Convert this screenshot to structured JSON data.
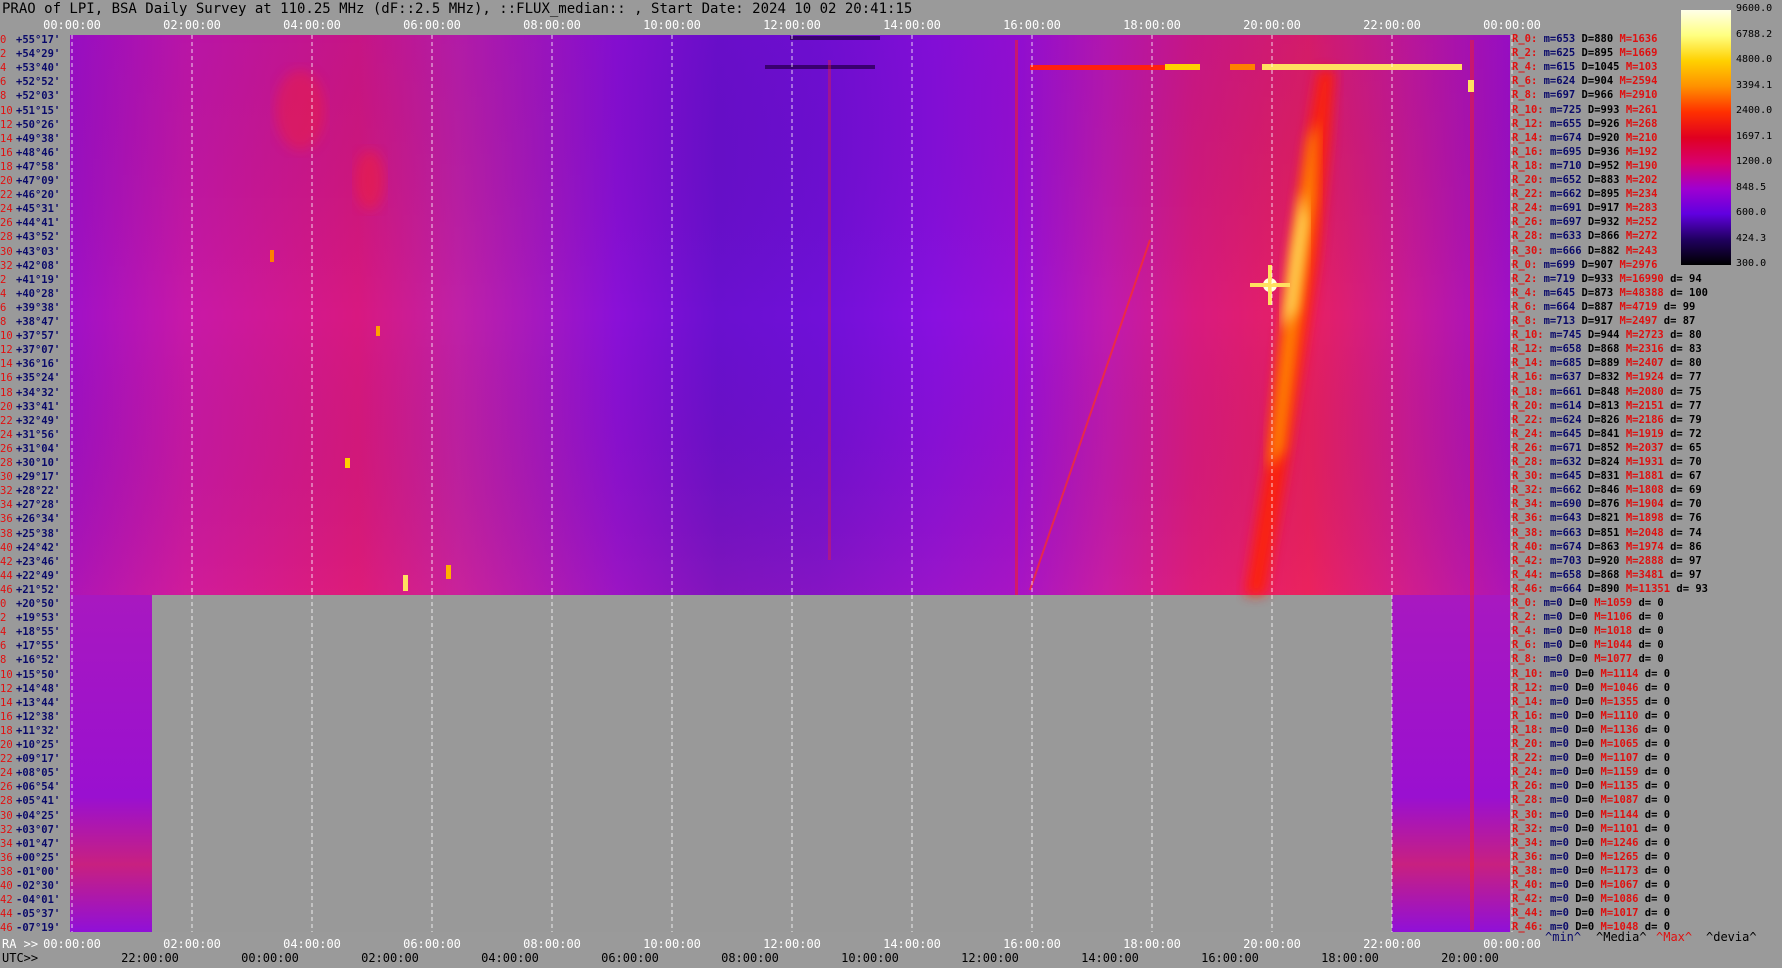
{
  "title": "PRAO of LPI, BSA Daily Survey at 110.25 MHz (dF::2.5 MHz), ::FLUX_median:: , Start Date: 2024 10 02 20:41:15",
  "top_axis": [
    "00:00:00",
    "02:00:00",
    "04:00:00",
    "06:00:00",
    "08:00:00",
    "10:00:00",
    "12:00:00",
    "14:00:00",
    "16:00:00",
    "18:00:00",
    "20:00:00",
    "22:00:00",
    "00:00:00"
  ],
  "ra_axis_label": "RA >>",
  "ra_axis": [
    "00:00:00",
    "02:00:00",
    "04:00:00",
    "06:00:00",
    "08:00:00",
    "10:00:00",
    "12:00:00",
    "14:00:00",
    "16:00:00",
    "18:00:00",
    "20:00:00",
    "22:00:00",
    "00:00:00"
  ],
  "utc_axis_label": "UTC>>",
  "utc_axis": [
    "22:00:00",
    "00:00:00",
    "02:00:00",
    "04:00:00",
    "06:00:00",
    "08:00:00",
    "10:00:00",
    "12:00:00",
    "14:00:00",
    "16:00:00",
    "18:00:00",
    "20:00:00"
  ],
  "declinations": [
    {
      "idx": "0",
      "dec": "+55°17'"
    },
    {
      "idx": "2",
      "dec": "+54°29'"
    },
    {
      "idx": "4",
      "dec": "+53°40'"
    },
    {
      "idx": "6",
      "dec": "+52°52'"
    },
    {
      "idx": "8",
      "dec": "+52°03'"
    },
    {
      "idx": "10",
      "dec": "+51°15'"
    },
    {
      "idx": "12",
      "dec": "+50°26'"
    },
    {
      "idx": "14",
      "dec": "+49°38'"
    },
    {
      "idx": "16",
      "dec": "+48°46'"
    },
    {
      "idx": "18",
      "dec": "+47°58'"
    },
    {
      "idx": "20",
      "dec": "+47°09'"
    },
    {
      "idx": "22",
      "dec": "+46°20'"
    },
    {
      "idx": "24",
      "dec": "+45°31'"
    },
    {
      "idx": "26",
      "dec": "+44°41'"
    },
    {
      "idx": "28",
      "dec": "+43°52'"
    },
    {
      "idx": "30",
      "dec": "+43°03'"
    },
    {
      "idx": "32",
      "dec": "+42°08'"
    },
    {
      "idx": "2",
      "dec": "+41°19'"
    },
    {
      "idx": "4",
      "dec": "+40°28'"
    },
    {
      "idx": "6",
      "dec": "+39°38'"
    },
    {
      "idx": "8",
      "dec": "+38°47'"
    },
    {
      "idx": "10",
      "dec": "+37°57'"
    },
    {
      "idx": "12",
      "dec": "+37°07'"
    },
    {
      "idx": "14",
      "dec": "+36°16'"
    },
    {
      "idx": "16",
      "dec": "+35°24'"
    },
    {
      "idx": "18",
      "dec": "+34°32'"
    },
    {
      "idx": "20",
      "dec": "+33°41'"
    },
    {
      "idx": "22",
      "dec": "+32°49'"
    },
    {
      "idx": "24",
      "dec": "+31°56'"
    },
    {
      "idx": "26",
      "dec": "+31°04'"
    },
    {
      "idx": "28",
      "dec": "+30°10'"
    },
    {
      "idx": "30",
      "dec": "+29°17'"
    },
    {
      "idx": "32",
      "dec": "+28°22'"
    },
    {
      "idx": "34",
      "dec": "+27°28'"
    },
    {
      "idx": "36",
      "dec": "+26°34'"
    },
    {
      "idx": "38",
      "dec": "+25°38'"
    },
    {
      "idx": "40",
      "dec": "+24°42'"
    },
    {
      "idx": "42",
      "dec": "+23°46'"
    },
    {
      "idx": "44",
      "dec": "+22°49'"
    },
    {
      "idx": "46",
      "dec": "+21°52'"
    },
    {
      "idx": "0",
      "dec": "+20°50'"
    },
    {
      "idx": "2",
      "dec": "+19°53'"
    },
    {
      "idx": "4",
      "dec": "+18°55'"
    },
    {
      "idx": "6",
      "dec": "+17°55'"
    },
    {
      "idx": "8",
      "dec": "+16°52'"
    },
    {
      "idx": "10",
      "dec": "+15°50'"
    },
    {
      "idx": "12",
      "dec": "+14°48'"
    },
    {
      "idx": "14",
      "dec": "+13°44'"
    },
    {
      "idx": "16",
      "dec": "+12°38'"
    },
    {
      "idx": "18",
      "dec": "+11°32'"
    },
    {
      "idx": "20",
      "dec": "+10°25'"
    },
    {
      "idx": "22",
      "dec": "+09°17'"
    },
    {
      "idx": "24",
      "dec": "+08°05'"
    },
    {
      "idx": "26",
      "dec": "+06°54'"
    },
    {
      "idx": "28",
      "dec": "+05°41'"
    },
    {
      "idx": "30",
      "dec": "+04°25'"
    },
    {
      "idx": "32",
      "dec": "+03°07'"
    },
    {
      "idx": "34",
      "dec": "+01°47'"
    },
    {
      "idx": "36",
      "dec": "+00°25'"
    },
    {
      "idx": "38",
      "dec": "-01°00'"
    },
    {
      "idx": "40",
      "dec": "-02°30'"
    },
    {
      "idx": "42",
      "dec": "-04°01'"
    },
    {
      "idx": "44",
      "dec": "-05°37'"
    },
    {
      "idx": "46",
      "dec": "-07°19'"
    }
  ],
  "stats": [
    {
      "r": "R_0:",
      "m": "m=653",
      "d": "D=880",
      "M": "M=1636",
      "dev": ""
    },
    {
      "r": "R_2:",
      "m": "m=625",
      "d": "D=895",
      "M": "M=1669",
      "dev": ""
    },
    {
      "r": "R_4:",
      "m": "m=615",
      "d": "D=1045",
      "M": "M=103",
      "dev": ""
    },
    {
      "r": "R_6:",
      "m": "m=624",
      "d": "D=904",
      "M": "M=2594",
      "dev": ""
    },
    {
      "r": "R_8:",
      "m": "m=697",
      "d": "D=966",
      "M": "M=2910",
      "dev": ""
    },
    {
      "r": "R_10:",
      "m": "m=725",
      "d": "D=993",
      "M": "M=261",
      "dev": ""
    },
    {
      "r": "R_12:",
      "m": "m=655",
      "d": "D=926",
      "M": "M=268",
      "dev": ""
    },
    {
      "r": "R_14:",
      "m": "m=674",
      "d": "D=920",
      "M": "M=210",
      "dev": ""
    },
    {
      "r": "R_16:",
      "m": "m=695",
      "d": "D=936",
      "M": "M=192",
      "dev": ""
    },
    {
      "r": "R_18:",
      "m": "m=710",
      "d": "D=952",
      "M": "M=190",
      "dev": ""
    },
    {
      "r": "R_20:",
      "m": "m=652",
      "d": "D=883",
      "M": "M=202",
      "dev": ""
    },
    {
      "r": "R_22:",
      "m": "m=662",
      "d": "D=895",
      "M": "M=234",
      "dev": ""
    },
    {
      "r": "R_24:",
      "m": "m=691",
      "d": "D=917",
      "M": "M=283",
      "dev": ""
    },
    {
      "r": "R_26:",
      "m": "m=697",
      "d": "D=932",
      "M": "M=252",
      "dev": ""
    },
    {
      "r": "R_28:",
      "m": "m=633",
      "d": "D=866",
      "M": "M=272",
      "dev": ""
    },
    {
      "r": "R_30:",
      "m": "m=666",
      "d": "D=882",
      "M": "M=243",
      "dev": ""
    },
    {
      "r": "R_0:",
      "m": "m=699",
      "d": "D=907",
      "M": "M=2976",
      "dev": ""
    },
    {
      "r": "R_2:",
      "m": "m=719",
      "d": "D=933",
      "M": "M=16990",
      "dev": "d= 94"
    },
    {
      "r": "R_4:",
      "m": "m=645",
      "d": "D=873",
      "M": "M=48388",
      "dev": "d= 100"
    },
    {
      "r": "R_6:",
      "m": "m=664",
      "d": "D=887",
      "M": "M=4719",
      "dev": "d= 99"
    },
    {
      "r": "R_8:",
      "m": "m=713",
      "d": "D=917",
      "M": "M=2497",
      "dev": "d= 87"
    },
    {
      "r": "R_10:",
      "m": "m=745",
      "d": "D=944",
      "M": "M=2723",
      "dev": "d= 80"
    },
    {
      "r": "R_12:",
      "m": "m=658",
      "d": "D=868",
      "M": "M=2316",
      "dev": "d= 83"
    },
    {
      "r": "R_14:",
      "m": "m=685",
      "d": "D=889",
      "M": "M=2407",
      "dev": "d= 80"
    },
    {
      "r": "R_16:",
      "m": "m=637",
      "d": "D=832",
      "M": "M=1924",
      "dev": "d= 77"
    },
    {
      "r": "R_18:",
      "m": "m=661",
      "d": "D=848",
      "M": "M=2080",
      "dev": "d= 75"
    },
    {
      "r": "R_20:",
      "m": "m=614",
      "d": "D=813",
      "M": "M=2151",
      "dev": "d= 77"
    },
    {
      "r": "R_22:",
      "m": "m=624",
      "d": "D=826",
      "M": "M=2186",
      "dev": "d= 79"
    },
    {
      "r": "R_24:",
      "m": "m=645",
      "d": "D=841",
      "M": "M=1919",
      "dev": "d= 72"
    },
    {
      "r": "R_26:",
      "m": "m=671",
      "d": "D=852",
      "M": "M=2037",
      "dev": "d= 65"
    },
    {
      "r": "R_28:",
      "m": "m=632",
      "d": "D=824",
      "M": "M=1931",
      "dev": "d= 70"
    },
    {
      "r": "R_30:",
      "m": "m=645",
      "d": "D=831",
      "M": "M=1881",
      "dev": "d= 67"
    },
    {
      "r": "R_32:",
      "m": "m=662",
      "d": "D=846",
      "M": "M=1808",
      "dev": "d= 69"
    },
    {
      "r": "R_34:",
      "m": "m=690",
      "d": "D=876",
      "M": "M=1904",
      "dev": "d= 70"
    },
    {
      "r": "R_36:",
      "m": "m=643",
      "d": "D=821",
      "M": "M=1898",
      "dev": "d= 76"
    },
    {
      "r": "R_38:",
      "m": "m=663",
      "d": "D=851",
      "M": "M=2048",
      "dev": "d= 74"
    },
    {
      "r": "R_40:",
      "m": "m=674",
      "d": "D=863",
      "M": "M=1974",
      "dev": "d= 86"
    },
    {
      "r": "R_42:",
      "m": "m=703",
      "d": "D=920",
      "M": "M=2888",
      "dev": "d= 97"
    },
    {
      "r": "R_44:",
      "m": "m=658",
      "d": "D=868",
      "M": "M=3481",
      "dev": "d= 97"
    },
    {
      "r": "R_46:",
      "m": "m=664",
      "d": "D=890",
      "M": "M=11351",
      "dev": "d= 93"
    },
    {
      "r": "R_0:",
      "m": "m=0",
      "d": "D=0",
      "M": "M=1059",
      "dev": "d= 0"
    },
    {
      "r": "R_2:",
      "m": "m=0",
      "d": "D=0",
      "M": "M=1106",
      "dev": "d= 0"
    },
    {
      "r": "R_4:",
      "m": "m=0",
      "d": "D=0",
      "M": "M=1018",
      "dev": "d= 0"
    },
    {
      "r": "R_6:",
      "m": "m=0",
      "d": "D=0",
      "M": "M=1044",
      "dev": "d= 0"
    },
    {
      "r": "R_8:",
      "m": "m=0",
      "d": "D=0",
      "M": "M=1077",
      "dev": "d= 0"
    },
    {
      "r": "R_10:",
      "m": "m=0",
      "d": "D=0",
      "M": "M=1114",
      "dev": "d= 0"
    },
    {
      "r": "R_12:",
      "m": "m=0",
      "d": "D=0",
      "M": "M=1046",
      "dev": "d= 0"
    },
    {
      "r": "R_14:",
      "m": "m=0",
      "d": "D=0",
      "M": "M=1355",
      "dev": "d= 0"
    },
    {
      "r": "R_16:",
      "m": "m=0",
      "d": "D=0",
      "M": "M=1110",
      "dev": "d= 0"
    },
    {
      "r": "R_18:",
      "m": "m=0",
      "d": "D=0",
      "M": "M=1136",
      "dev": "d= 0"
    },
    {
      "r": "R_20:",
      "m": "m=0",
      "d": "D=0",
      "M": "M=1065",
      "dev": "d= 0"
    },
    {
      "r": "R_22:",
      "m": "m=0",
      "d": "D=0",
      "M": "M=1107",
      "dev": "d= 0"
    },
    {
      "r": "R_24:",
      "m": "m=0",
      "d": "D=0",
      "M": "M=1159",
      "dev": "d= 0"
    },
    {
      "r": "R_26:",
      "m": "m=0",
      "d": "D=0",
      "M": "M=1135",
      "dev": "d= 0"
    },
    {
      "r": "R_28:",
      "m": "m=0",
      "d": "D=0",
      "M": "M=1087",
      "dev": "d= 0"
    },
    {
      "r": "R_30:",
      "m": "m=0",
      "d": "D=0",
      "M": "M=1144",
      "dev": "d= 0"
    },
    {
      "r": "R_32:",
      "m": "m=0",
      "d": "D=0",
      "M": "M=1101",
      "dev": "d= 0"
    },
    {
      "r": "R_34:",
      "m": "m=0",
      "d": "D=0",
      "M": "M=1246",
      "dev": "d= 0"
    },
    {
      "r": "R_36:",
      "m": "m=0",
      "d": "D=0",
      "M": "M=1265",
      "dev": "d= 0"
    },
    {
      "r": "R_38:",
      "m": "m=0",
      "d": "D=0",
      "M": "M=1173",
      "dev": "d= 0"
    },
    {
      "r": "R_40:",
      "m": "m=0",
      "d": "D=0",
      "M": "M=1067",
      "dev": "d= 0"
    },
    {
      "r": "R_42:",
      "m": "m=0",
      "d": "D=0",
      "M": "M=1086",
      "dev": "d= 0"
    },
    {
      "r": "R_44:",
      "m": "m=0",
      "d": "D=0",
      "M": "M=1017",
      "dev": "d= 0"
    },
    {
      "r": "R_46:",
      "m": "m=0",
      "d": "D=0",
      "M": "M=1048",
      "dev": "d= 0"
    }
  ],
  "legend": {
    "min": "^min^",
    "median": "^Media^",
    "max": "^Max^",
    "dev": "^devia^"
  },
  "colorbar": {
    "values": [
      "9600.0",
      "6788.2",
      "4800.0",
      "3394.1",
      "2400.0",
      "1697.1",
      "1200.0",
      "848.5",
      "600.0",
      "424.3",
      "300.0"
    ],
    "colors": [
      "#ffffe8",
      "#ffff80",
      "#ffd000",
      "#ff9000",
      "#ff3000",
      "#e00020",
      "#d80070",
      "#a000d0",
      "#6000e0",
      "#200060",
      "#000000"
    ]
  },
  "colors": {
    "background": "#9a9a9a",
    "no_data": "#999999",
    "grid": "#ffffff",
    "label_red": "#e01010",
    "label_blue": "#0a0a6a"
  }
}
